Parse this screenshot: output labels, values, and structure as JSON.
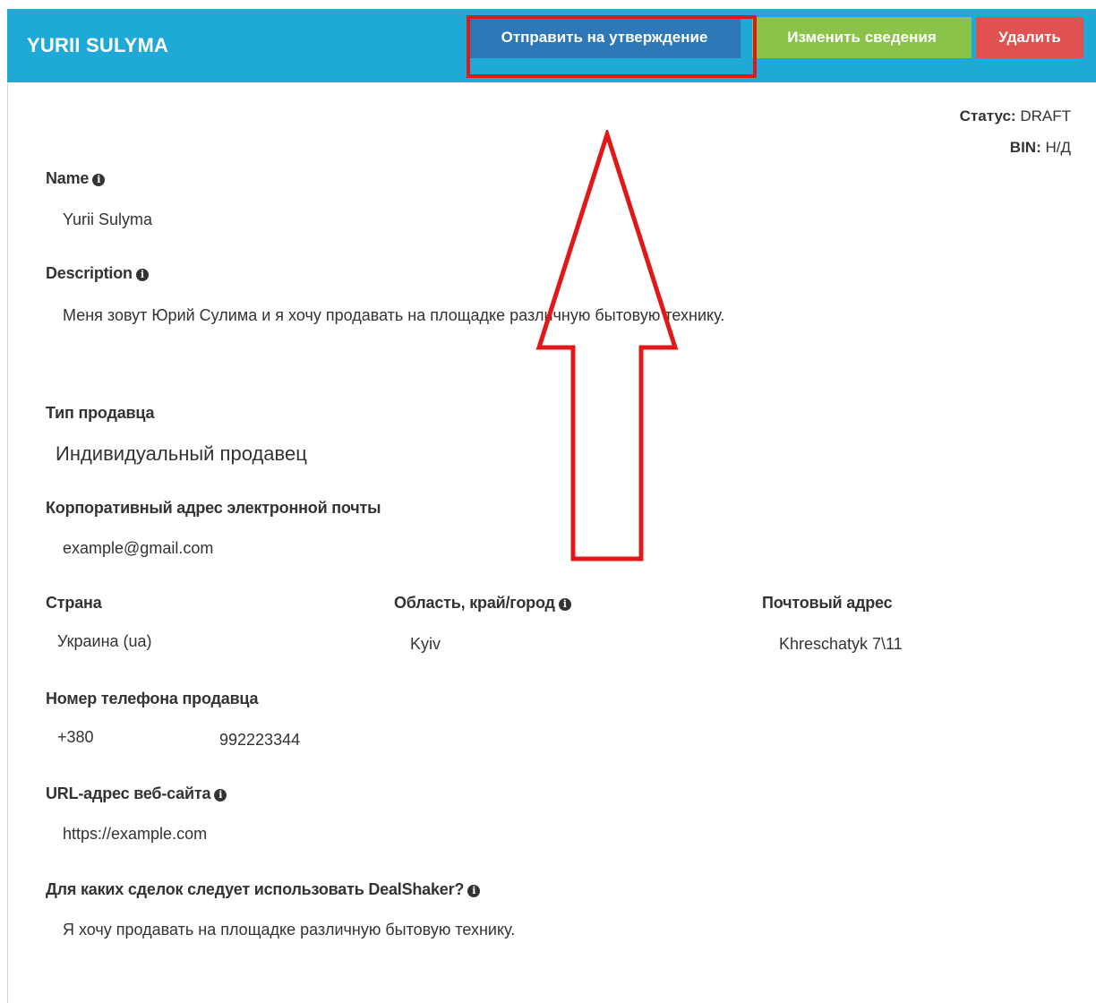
{
  "header": {
    "title": "YURII SULYMA",
    "buttons": {
      "submit": "Отправить на утверждение",
      "edit": "Изменить сведения",
      "delete": "Удалить"
    }
  },
  "status": {
    "label": "Статус:",
    "value": "DRAFT"
  },
  "bin": {
    "label": "BIN:",
    "value": "Н/Д"
  },
  "fields": {
    "name": {
      "label": "Name",
      "value": "Yurii Sulyma"
    },
    "description": {
      "label": "Description",
      "value": "Меня зовут Юрий Сулима и я хочу продавать на площадке различную бытовую технику."
    },
    "seller_type": {
      "label": "Тип продавца",
      "value": "Индивидуальный продавец"
    },
    "email": {
      "label": "Корпоративный адрес электронной почты",
      "value": "example@gmail.com"
    },
    "country": {
      "label": "Страна",
      "value": "Украина (ua)"
    },
    "region": {
      "label": "Область, край/город",
      "value": "Kyiv"
    },
    "postal": {
      "label": "Почтовый адрес",
      "value": "Khreschatyk 7\\11"
    },
    "phone": {
      "label": "Номер телефона продавца",
      "code": "+380",
      "number": "992223344"
    },
    "website": {
      "label": "URL-адрес веб-сайта",
      "value": "https://example.com"
    },
    "dealshaker": {
      "label": "Для каких сделок следует использовать DealShaker?",
      "value": "Я хочу продавать на площадке различную бытовую технику."
    }
  },
  "icons": {
    "info": "info-circle-icon",
    "annotation": "red-arrow-up"
  },
  "colors": {
    "header": "#1fa9d6",
    "submit_button": "#2e78b7",
    "edit_button": "#8bc34a",
    "delete_button": "#e05252",
    "annotation": "#e01818"
  }
}
